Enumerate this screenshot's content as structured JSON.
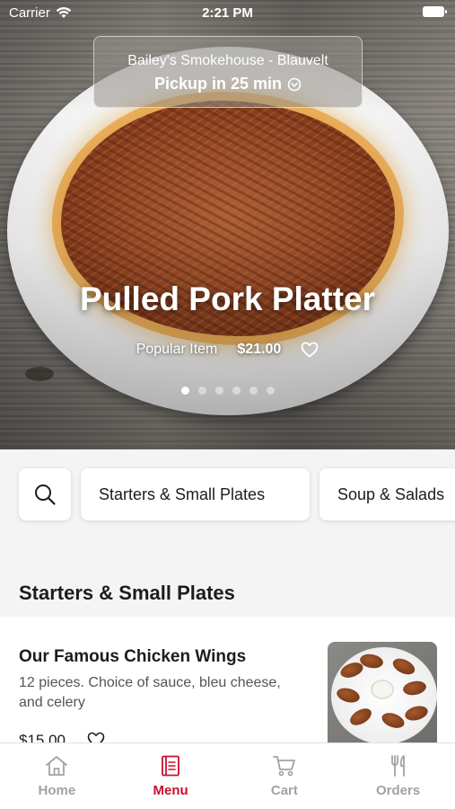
{
  "status_bar": {
    "carrier": "Carrier",
    "time": "2:21 PM"
  },
  "store": {
    "name": "Bailey's Smokehouse - Blauvelt",
    "pickup": "Pickup in 25 min"
  },
  "hero": {
    "title": "Pulled Pork Platter",
    "tag": "Popular Item",
    "price": "$21.00",
    "dots_total": 6,
    "active_dot": 1
  },
  "categories": [
    "Starters & Small Plates",
    "Soup & Salads"
  ],
  "section_title": "Starters & Small Plates",
  "item": {
    "name": "Our Famous Chicken Wings",
    "description": "12 pieces. Choice of sauce, bleu cheese, and celery",
    "price": "$15.00"
  },
  "tabs": [
    {
      "label": "Home",
      "icon": "home-icon",
      "active": false
    },
    {
      "label": "Menu",
      "icon": "menu-book-icon",
      "active": true
    },
    {
      "label": "Cart",
      "icon": "cart-icon",
      "active": false
    },
    {
      "label": "Orders",
      "icon": "fork-knife-icon",
      "active": false
    }
  ],
  "colors": {
    "accent": "#c8102e",
    "inactive_tab": "#a2a2a2",
    "background": "#f4f4f4"
  }
}
